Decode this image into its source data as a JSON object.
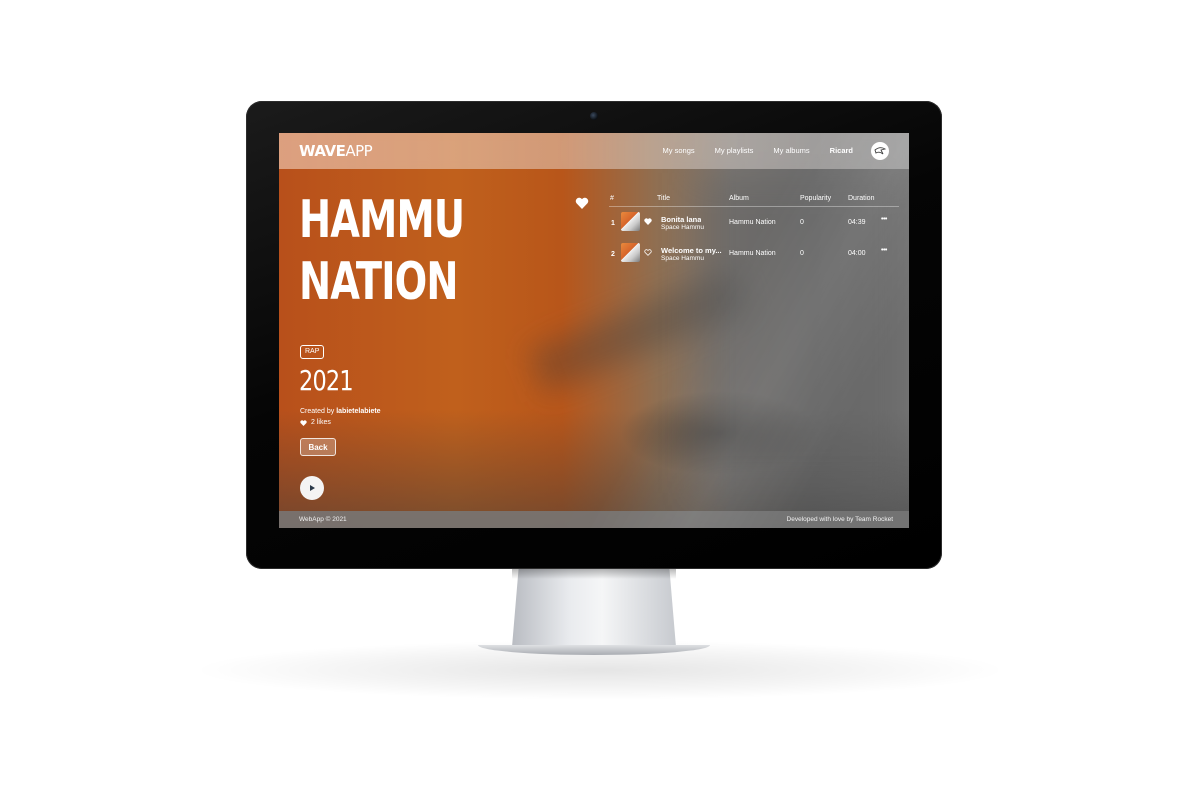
{
  "app": {
    "logo_bold": "WAVE",
    "logo_thin": "APP"
  },
  "nav": {
    "links": [
      "My songs",
      "My playlists",
      "My albums"
    ],
    "user": "Ricard"
  },
  "album": {
    "title_line1": "HAMMU",
    "title_line2": "NATION",
    "genre": "RAP",
    "year": "2021",
    "created_by_label": "Created by",
    "created_by_user": "labietelabiete",
    "likes": "2 likes",
    "back_label": "Back"
  },
  "tracks": {
    "headers": {
      "num": "#",
      "title": "Title",
      "album": "Album",
      "popularity": "Popularity",
      "duration": "Duration"
    },
    "rows": [
      {
        "num": "1",
        "title": "Bonita lana",
        "artist": "Space Hammu",
        "album": "Hammu Nation",
        "popularity": "0",
        "duration": "04:39",
        "liked": true
      },
      {
        "num": "2",
        "title": "Welcome to my...",
        "artist": "Space Hammu",
        "album": "Hammu Nation",
        "popularity": "0",
        "duration": "04:00",
        "liked": false
      }
    ],
    "more_label": "•••"
  },
  "footer": {
    "left": "WebApp © 2021",
    "right": "Developed with love by Team Rocket"
  },
  "colors": {
    "accent_orange": "#c0601c",
    "text": "#ffffff",
    "play_icon": "#2b3a4a"
  }
}
